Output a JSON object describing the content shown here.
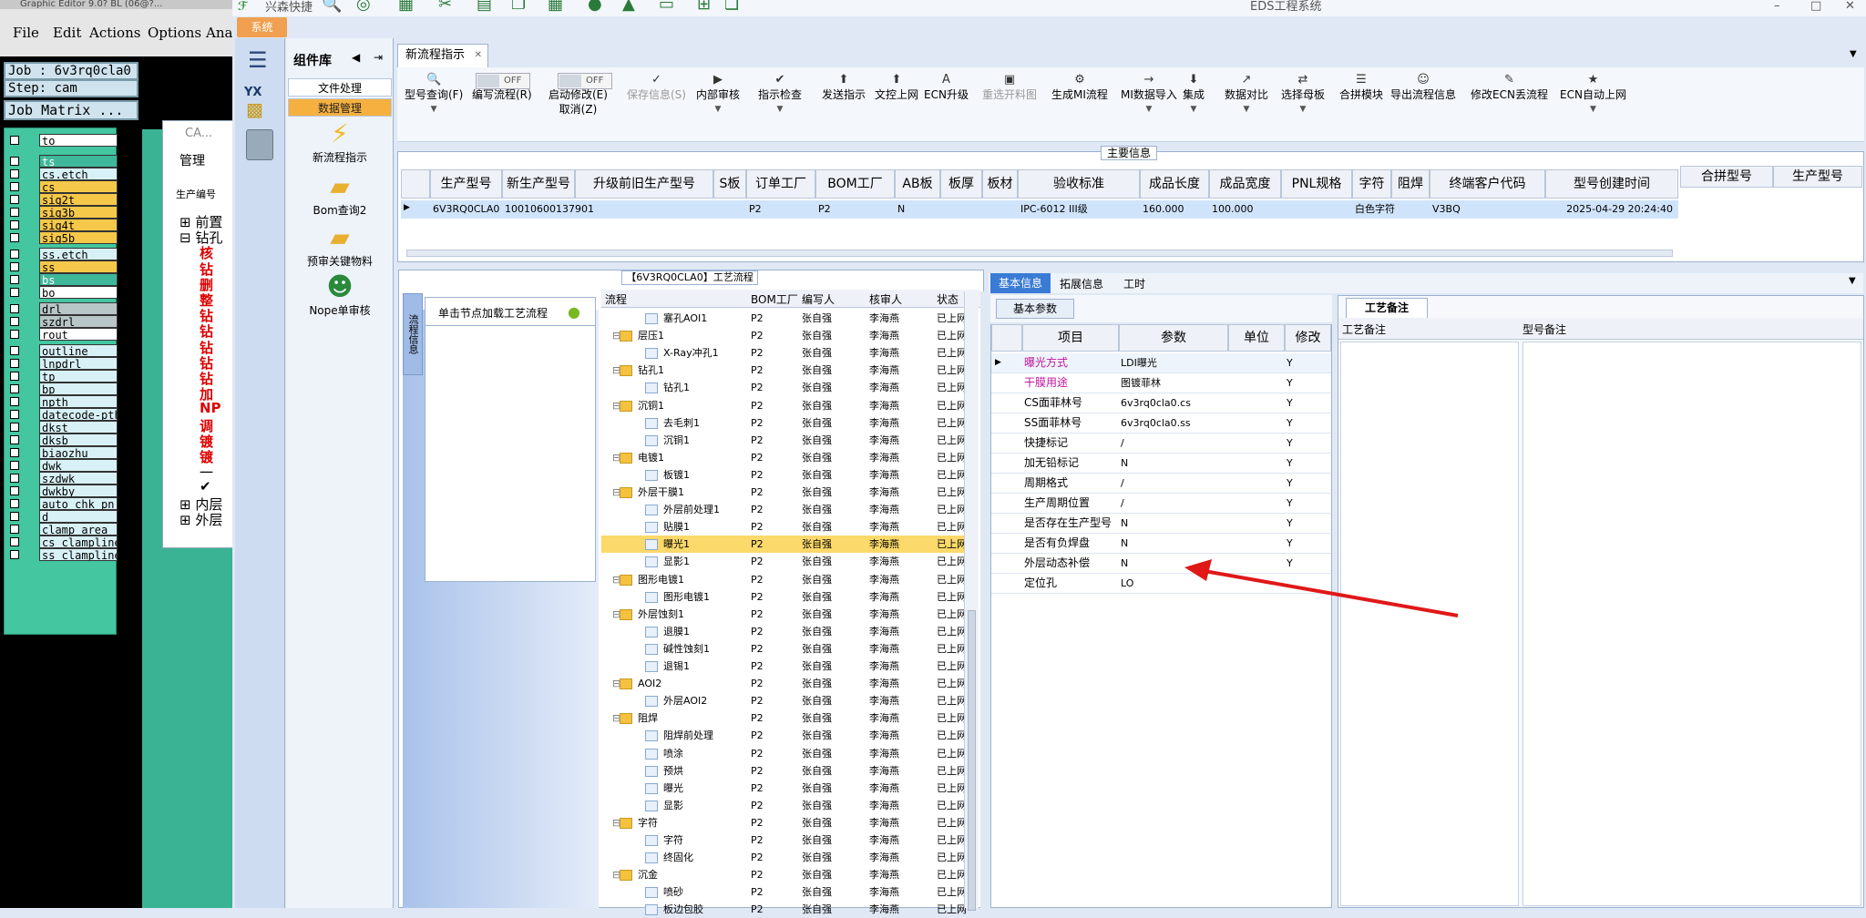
{
  "graphic_editor": {
    "title": "Graphic Editor 9.0? BL (06@?...",
    "menu": [
      "File",
      "Edit",
      "Actions",
      "Options",
      "Ana"
    ],
    "job": "Job : 6v3rq0cla0",
    "step": "Step: cam",
    "job_matrix": "Job Matrix ...",
    "layers": [
      {
        "name": "to",
        "c": "w"
      },
      {
        "name": "ts",
        "c": "g"
      },
      {
        "name": "cs.etch",
        "c": "lb"
      },
      {
        "name": "cs",
        "c": "y"
      },
      {
        "name": "sig2t",
        "c": "y"
      },
      {
        "name": "sig3b",
        "c": "y"
      },
      {
        "name": "sig4t",
        "c": "y"
      },
      {
        "name": "sig5b",
        "c": "y"
      },
      {
        "name": "ss.etch",
        "c": "lb"
      },
      {
        "name": "ss",
        "c": "y"
      },
      {
        "name": "bs",
        "c": "g"
      },
      {
        "name": "bo",
        "c": "w"
      },
      {
        "name": "drl",
        "c": "gr"
      },
      {
        "name": "szdrl",
        "c": "gr"
      },
      {
        "name": "rout",
        "c": "w"
      },
      {
        "name": "outline",
        "c": "lb"
      },
      {
        "name": "lnpdrl",
        "c": "lb"
      },
      {
        "name": "tp",
        "c": "lb"
      },
      {
        "name": "bp",
        "c": "lb"
      },
      {
        "name": "npth",
        "c": "lb"
      },
      {
        "name": "datecode-pth",
        "c": "lb"
      },
      {
        "name": "dkst",
        "c": "lb"
      },
      {
        "name": "dksb",
        "c": "lb"
      },
      {
        "name": "biaozhu",
        "c": "lb"
      },
      {
        "name": "dwk",
        "c": "lb"
      },
      {
        "name": "szdwk",
        "c": "lb"
      },
      {
        "name": "dwkby",
        "c": "lb"
      },
      {
        "name": "auto_chk_pn.",
        "c": "lb"
      },
      {
        "name": "d",
        "c": "lb"
      },
      {
        "name": "clamp_area",
        "c": "lb"
      },
      {
        "name": "cs_clampline",
        "c": "lb"
      },
      {
        "name": "ss_clampline",
        "c": "lb"
      }
    ]
  },
  "cam_window": {
    "title": "CA...",
    "menu": "管理",
    "label": "生产编号",
    "tree": [
      {
        "t": "⊞ 前置",
        "red": false
      },
      {
        "t": "⊟ 钻孔",
        "red": false
      },
      {
        "t": "核",
        "red": true
      },
      {
        "t": "钻",
        "red": true
      },
      {
        "t": "删",
        "red": true
      },
      {
        "t": "整",
        "red": true
      },
      {
        "t": "钻",
        "red": true
      },
      {
        "t": "钻",
        "red": true
      },
      {
        "t": "钻",
        "red": true
      },
      {
        "t": "钻",
        "red": true
      },
      {
        "t": "钻",
        "red": true
      },
      {
        "t": "加",
        "red": true
      },
      {
        "t": "NP",
        "red": true
      },
      {
        "t": "调",
        "red": true
      },
      {
        "t": "镀",
        "red": true
      },
      {
        "t": "镀",
        "red": true
      },
      {
        "t": "一",
        "red": false
      },
      {
        "t": "✔",
        "red": false
      },
      {
        "t": "⊞ 内层",
        "red": false
      },
      {
        "t": "⊞ 外层",
        "red": false
      }
    ]
  },
  "eds": {
    "title": "EDS工程系统",
    "quick": "兴森快捷",
    "sys_button": "系统",
    "sidebar_labels": [
      "YX"
    ],
    "comp_lib": {
      "title": "组件库",
      "tabs": [
        "文件处理",
        "数据管理"
      ],
      "items": [
        "新流程指示",
        "Bom查询2",
        "预审关键物料",
        "Nope单审核"
      ]
    },
    "tab": "新流程指示",
    "ribbon": [
      {
        "i": "🔍",
        "l": "型号查询(F)",
        "arr": true,
        "dis": false
      },
      {
        "i": "",
        "l": "编写流程(R)",
        "arr": false,
        "dis": false
      },
      {
        "i": "",
        "l": "启动修改(E)",
        "l2": "取消(Z)",
        "arr": false,
        "dis": false
      },
      {
        "i": "✓",
        "l": "保存信息(S)",
        "arr": false,
        "dis": true
      },
      {
        "i": "▶",
        "l": "内部审核",
        "arr": true,
        "dis": false
      },
      {
        "i": "✔",
        "l": "指示检查",
        "arr": true,
        "dis": false
      },
      {
        "i": "⬆",
        "l": "发送指示",
        "arr": false,
        "dis": false
      },
      {
        "i": "⬆",
        "l": "文控上网",
        "arr": false,
        "dis": false
      },
      {
        "i": "A",
        "l": "ECN升级",
        "arr": false,
        "dis": false
      },
      {
        "i": "▣",
        "l": "重选开料图",
        "arr": false,
        "dis": true
      },
      {
        "i": "⚙",
        "l": "生成MI流程",
        "arr": false,
        "dis": false
      },
      {
        "i": "→",
        "l": "MI数据导入",
        "arr": true,
        "dis": false
      },
      {
        "i": "⬇",
        "l": "集成",
        "arr": true,
        "dis": false
      },
      {
        "i": "↗",
        "l": "数据对比",
        "arr": true,
        "dis": false
      },
      {
        "i": "⇄",
        "l": "选择母板",
        "arr": true,
        "dis": false
      },
      {
        "i": "☰",
        "l": "合拼模块",
        "arr": false,
        "dis": false
      },
      {
        "i": "☺",
        "l": "导出流程信息",
        "arr": false,
        "dis": false
      },
      {
        "i": "✎",
        "l": "修改ECN丢流程",
        "arr": false,
        "dis": false
      },
      {
        "i": "★",
        "l": "ECN自动上网",
        "arr": true,
        "dis": false
      }
    ],
    "toggles": [
      "OFF",
      "OFF"
    ],
    "main_info_title": "主要信息",
    "columns": [
      "生产型号",
      "新生产型号",
      "升级前旧生产型号",
      "S板",
      "订单工厂",
      "BOM工厂",
      "AB板",
      "板厚",
      "板材",
      "验收标准",
      "成品长度",
      "成品宽度",
      "PNL规格",
      "字符",
      "阻焊",
      "终端客户代码",
      "型号创建时间"
    ],
    "right_columns": [
      "合拼型号",
      "生产型号"
    ],
    "row": [
      "6V3RQ0CLA0",
      "10010600137901",
      "",
      "",
      "P2",
      "P2",
      "N",
      "",
      "",
      "IPC-6012 III级",
      "160.000",
      "100.000",
      "",
      "白色字符",
      "",
      "V3BQ",
      "2025-04-29 20:24:40"
    ],
    "flow_title": "【6V3RQ0CLA0】工艺流程",
    "flow_side_tab": "流程信息",
    "flow_hint": "单击节点加载工艺流程",
    "flow_cols": [
      "流程",
      "BOM工厂",
      "编写人",
      "核审人",
      "状态"
    ],
    "flow_rows": [
      {
        "n": "塞孔AOI1",
        "lv": 2,
        "f": false,
        "hl": false
      },
      {
        "n": "层压1",
        "lv": 1,
        "f": true,
        "hl": false
      },
      {
        "n": "X-Ray冲孔1",
        "lv": 2,
        "f": false,
        "hl": false
      },
      {
        "n": "钻孔1",
        "lv": 1,
        "f": true,
        "hl": false
      },
      {
        "n": "钻孔1",
        "lv": 2,
        "f": false,
        "hl": false
      },
      {
        "n": "沉铜1",
        "lv": 1,
        "f": true,
        "hl": false
      },
      {
        "n": "去毛刺1",
        "lv": 2,
        "f": false,
        "hl": false
      },
      {
        "n": "沉铜1",
        "lv": 2,
        "f": false,
        "hl": false
      },
      {
        "n": "电镀1",
        "lv": 1,
        "f": true,
        "hl": false
      },
      {
        "n": "板镀1",
        "lv": 2,
        "f": false,
        "hl": false
      },
      {
        "n": "外层干膜1",
        "lv": 1,
        "f": true,
        "hl": false
      },
      {
        "n": "外层前处理1",
        "lv": 2,
        "f": false,
        "hl": false
      },
      {
        "n": "贴膜1",
        "lv": 2,
        "f": false,
        "hl": false
      },
      {
        "n": "曝光1",
        "lv": 2,
        "f": false,
        "hl": true
      },
      {
        "n": "显影1",
        "lv": 2,
        "f": false,
        "hl": false
      },
      {
        "n": "图形电镀1",
        "lv": 1,
        "f": true,
        "hl": false
      },
      {
        "n": "图形电镀1",
        "lv": 2,
        "f": false,
        "hl": false
      },
      {
        "n": "外层蚀刻1",
        "lv": 1,
        "f": true,
        "hl": false
      },
      {
        "n": "退膜1",
        "lv": 2,
        "f": false,
        "hl": false
      },
      {
        "n": "碱性蚀刻1",
        "lv": 2,
        "f": false,
        "hl": false
      },
      {
        "n": "退锡1",
        "lv": 2,
        "f": false,
        "hl": false
      },
      {
        "n": "AOI2",
        "lv": 1,
        "f": true,
        "hl": false
      },
      {
        "n": "外层AOI2",
        "lv": 2,
        "f": false,
        "hl": false
      },
      {
        "n": "阻焊",
        "lv": 1,
        "f": true,
        "hl": false
      },
      {
        "n": "阻焊前处理",
        "lv": 2,
        "f": false,
        "hl": false
      },
      {
        "n": "喷涂",
        "lv": 2,
        "f": false,
        "hl": false
      },
      {
        "n": "预烘",
        "lv": 2,
        "f": false,
        "hl": false
      },
      {
        "n": "曝光",
        "lv": 2,
        "f": false,
        "hl": false
      },
      {
        "n": "显影",
        "lv": 2,
        "f": false,
        "hl": false
      },
      {
        "n": "字符",
        "lv": 1,
        "f": true,
        "hl": false
      },
      {
        "n": "字符",
        "lv": 2,
        "f": false,
        "hl": false
      },
      {
        "n": "终固化",
        "lv": 2,
        "f": false,
        "hl": false
      },
      {
        "n": "沉金",
        "lv": 1,
        "f": true,
        "hl": false
      },
      {
        "n": "喷砂",
        "lv": 2,
        "f": false,
        "hl": false
      },
      {
        "n": "板边包胶",
        "lv": 2,
        "f": false,
        "hl": false
      }
    ],
    "flow_factory": "P2",
    "flow_writer": "张自强",
    "flow_checker": "李海燕",
    "flow_status": "已上网",
    "info_tabs": [
      "基本信息",
      "拓展信息",
      "工时"
    ],
    "basic_param_tab": "基本参数",
    "basic_cols": [
      "项目",
      "参数",
      "单位",
      "修改"
    ],
    "basic_rows": [
      {
        "k": "曝光方式",
        "v": "LDI曝光",
        "m": "Y",
        "kc": "#c0149c"
      },
      {
        "k": "干膜用途",
        "v": "图镀菲林",
        "m": "Y",
        "kc": "#c0149c"
      },
      {
        "k": "CS面菲林号",
        "v": "6v3rq0cla0.cs",
        "m": "Y",
        "kc": "#000000"
      },
      {
        "k": "SS面菲林号",
        "v": "6v3rq0cla0.ss",
        "m": "Y",
        "kc": "#000000"
      },
      {
        "k": "快捷标记",
        "v": "/",
        "m": "Y",
        "kc": "#000000"
      },
      {
        "k": "加无铅标记",
        "v": "N",
        "m": "Y",
        "kc": "#000000"
      },
      {
        "k": "周期格式",
        "v": "/",
        "m": "Y",
        "kc": "#000000"
      },
      {
        "k": "生产周期位置",
        "v": "/",
        "m": "Y",
        "kc": "#000000"
      },
      {
        "k": "是否存在生产型号",
        "v": "N",
        "m": "Y",
        "kc": "#000000"
      },
      {
        "k": "是否有负焊盘",
        "v": "N",
        "m": "Y",
        "kc": "#000000"
      },
      {
        "k": "外层动态补偿",
        "v": "N",
        "m": "Y",
        "kc": "#000000"
      },
      {
        "k": "定位孔",
        "v": "LO",
        "m": "",
        "kc": "#000000"
      }
    ],
    "remark_tab": "工艺备注",
    "remark_cols": [
      "工艺备注",
      "型号备注"
    ]
  },
  "colors": {
    "accent": "#3a7bd5",
    "red_arrow": "#e01818",
    "highlight": "#fbd96a"
  }
}
